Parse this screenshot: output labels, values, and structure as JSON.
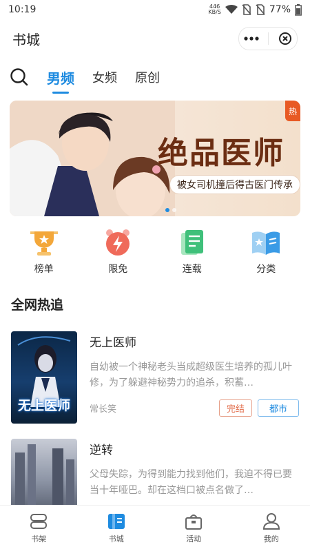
{
  "status": {
    "time": "10:19",
    "speed": "446",
    "speed_unit": "KB/S",
    "battery": "77%"
  },
  "header": {
    "title": "书城"
  },
  "tabs": [
    {
      "label": "男频"
    },
    {
      "label": "女频"
    },
    {
      "label": "原创"
    }
  ],
  "banner": {
    "title": "绝品医师",
    "subtitle": "被女司机撞后得古医门传承",
    "badge": "热"
  },
  "quick": [
    {
      "label": "榜单",
      "icon": "trophy-icon"
    },
    {
      "label": "限免",
      "icon": "lightning-clock-icon"
    },
    {
      "label": "连载",
      "icon": "document-icon"
    },
    {
      "label": "分类",
      "icon": "open-book-icon"
    }
  ],
  "section": {
    "title": "全网热追"
  },
  "books": [
    {
      "title": "无上医师",
      "desc": "自幼被一个神秘老头当成超级医生培养的孤儿叶修，为了躲避神秘势力的追杀，积蓄…",
      "author": "常长笑",
      "status": "完结",
      "genre": "都市",
      "cover_text": "无上医师"
    },
    {
      "title": "逆转",
      "desc": "父母失踪，为得到能力找到他们，我迫不得已要当十年哑巴。却在这档口被点名做了…",
      "author": "",
      "status": "",
      "genre": ""
    }
  ],
  "tabbar": [
    {
      "label": "书架",
      "icon": "bookshelf-icon"
    },
    {
      "label": "书城",
      "icon": "bookstore-icon"
    },
    {
      "label": "活动",
      "icon": "gift-box-icon"
    },
    {
      "label": "我的",
      "icon": "profile-icon"
    }
  ],
  "colors": {
    "accent": "#1e8be0",
    "status_tag": "#e26d4b"
  }
}
